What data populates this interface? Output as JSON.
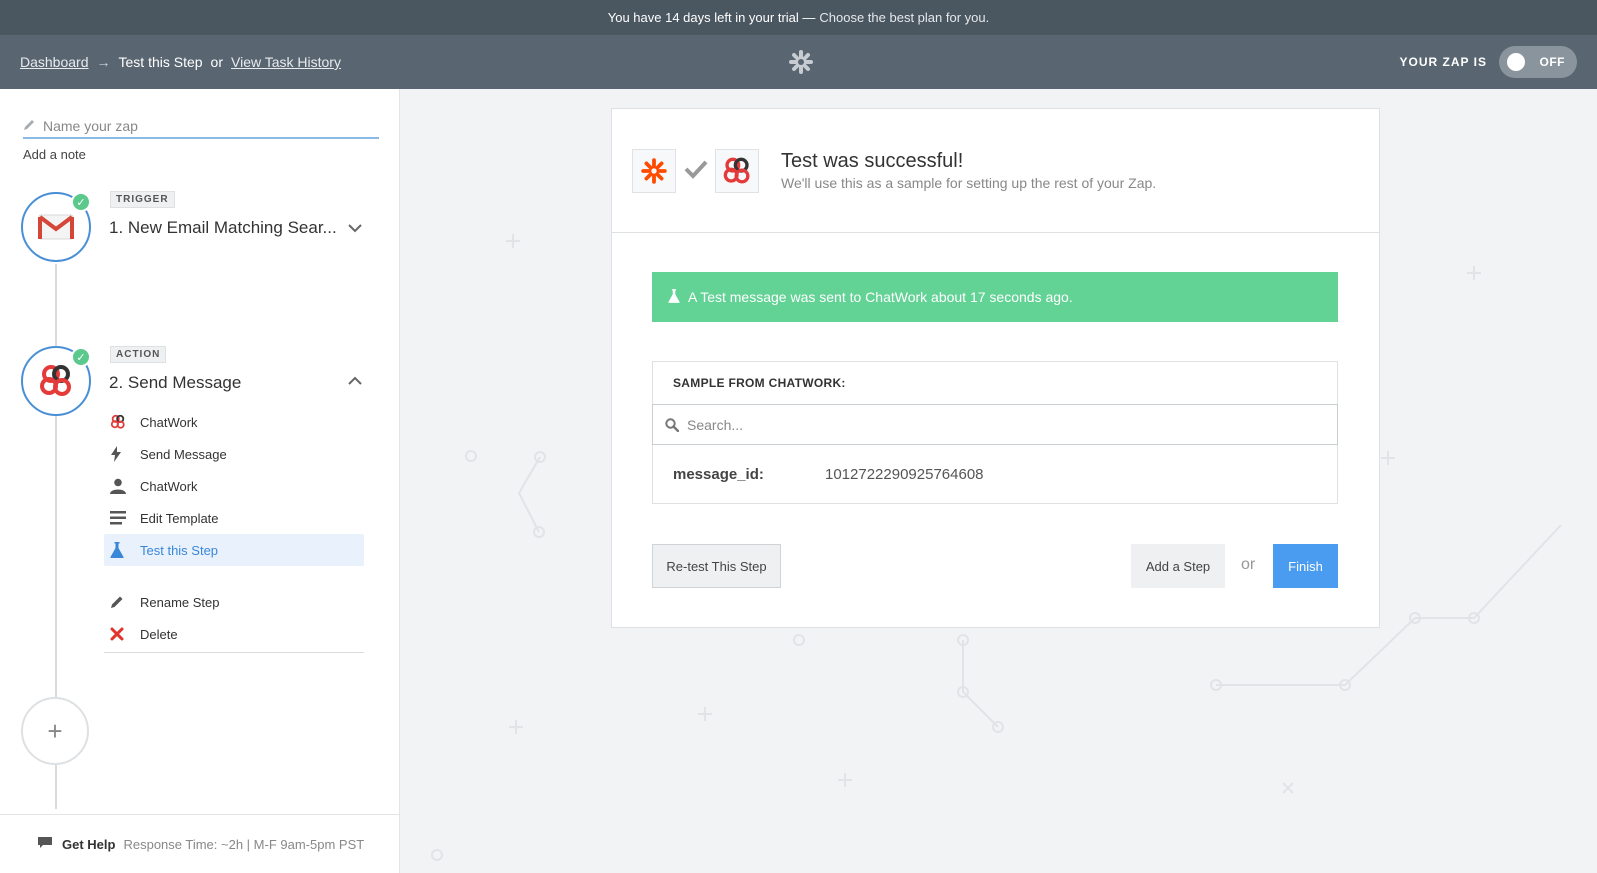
{
  "trial_bar": {
    "prefix": "You have 14 days left in your trial —",
    "link": "Choose the best plan for you."
  },
  "header": {
    "breadcrumb_dashboard": "Dashboard",
    "breadcrumb_arrow": "→",
    "breadcrumb_current": "Test this Step",
    "breadcrumb_or": "or",
    "breadcrumb_history": "View Task History",
    "zap_status_label": "YOUR ZAP IS",
    "zap_toggle_value": "OFF"
  },
  "sidebar": {
    "name_placeholder": "Name your zap",
    "add_note": "Add a note",
    "trigger": {
      "tag": "TRIGGER",
      "title": "1. New Email Matching Sear..."
    },
    "action": {
      "tag": "ACTION",
      "title": "2. Send Message",
      "submenu": [
        {
          "label": "ChatWork",
          "icon": "chatwork-icon"
        },
        {
          "label": "Send Message",
          "icon": "bolt-icon"
        },
        {
          "label": "ChatWork",
          "icon": "user-icon"
        },
        {
          "label": "Edit Template",
          "icon": "lines-icon"
        },
        {
          "label": "Test this Step",
          "icon": "flask-icon"
        }
      ],
      "rename": "Rename Step",
      "delete": "Delete"
    },
    "help": {
      "label": "Get Help",
      "response": "Response Time: ~2h | M-F 9am-5pm PST"
    }
  },
  "card": {
    "success_title": "Test was successful!",
    "success_sub": "We'll use this as a sample for setting up the rest of your Zap.",
    "alert": "A Test message was sent to ChatWork about 17 seconds ago.",
    "sample_header": "SAMPLE FROM CHATWORK:",
    "search_placeholder": "Search...",
    "fields": [
      {
        "key": "message_id:",
        "value": "1012722290925764608"
      }
    ],
    "retest": "Re-test This Step",
    "add_step": "Add a Step",
    "or": "or",
    "finish": "Finish"
  },
  "colors": {
    "accent": "#4a9cf0",
    "success": "#62d295",
    "header": "#596570",
    "trial_bar": "#4a5660"
  }
}
